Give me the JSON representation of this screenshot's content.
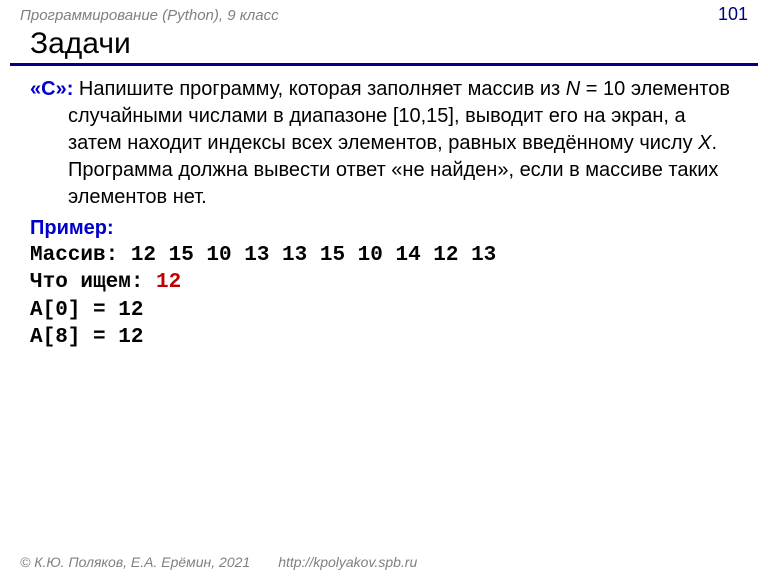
{
  "header": {
    "course": "Программирование (Python), 9 класс",
    "page": "101"
  },
  "title": "Задачи",
  "task": {
    "label": "«C»:",
    "text_before_N": " Напишите программу, которая заполняет массив из ",
    "N_expr": "N",
    "eq_ten": " = 10 элементов случайными числами в диапазоне [10,15], выводит его на экран, а затем находит индексы всех элементов, равных введённому числу ",
    "X_var": "X",
    "after_X": ". Программа должна вывести ответ «не найден», если в массиве таких элементов нет."
  },
  "example": {
    "label": "Пример:",
    "line_array_label": "Массив:",
    "line_array_values": " 12 15 10 13 13 15 10 14 12 13",
    "line_search_label": "Что ищем:",
    "line_search_value": " 12",
    "line_a0": "A[0] = 12",
    "line_a8": "A[8] = 12"
  },
  "footer": {
    "copyright": "© К.Ю. Поляков, Е.А. Ерёмин, 2021",
    "url": "http://kpolyakov.spb.ru"
  }
}
